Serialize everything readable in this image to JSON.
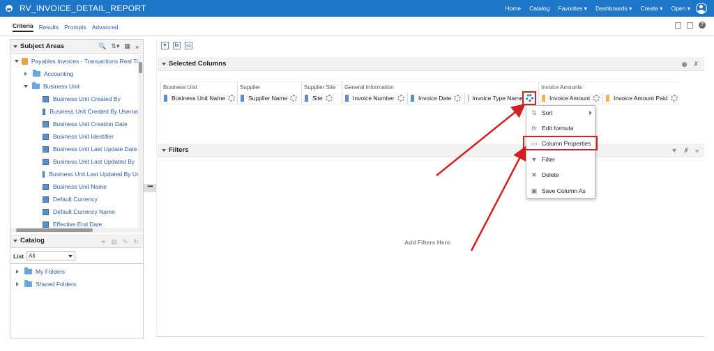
{
  "app": {
    "title": "RV_INVOICE_DETAIL_REPORT",
    "nav": [
      "Home",
      "Catalog",
      "Favorites ▾",
      "Dashboards ▾",
      "Create ▾",
      "Open ▾"
    ]
  },
  "tabs": [
    "Criteria",
    "Results",
    "Prompts",
    "Advanced"
  ],
  "subject_areas": {
    "header": "Subject Areas",
    "root": "Payables Invoices - Transactions Real Tim",
    "folders": [
      "Accounting",
      "Business Unit"
    ],
    "columns": [
      "Business Unit Created By",
      "Business Unit Created By Usernam",
      "Business Unit Creation Date",
      "Business Unit Identifier",
      "Business Unit Last Update Date",
      "Business Unit Last Updated By",
      "Business Unit Last Updated By Use",
      "Business Unit Name",
      "Default Currency",
      "Default Currency Name",
      "Effective End Date"
    ]
  },
  "catalog": {
    "header": "Catalog",
    "list_label": "List",
    "list_value": "All",
    "folders": [
      "My Folders",
      "Shared Folders"
    ]
  },
  "selected_columns": {
    "header": "Selected Columns",
    "groups": [
      "Business Unit",
      "Supplier",
      "Supplier Site",
      "General Information",
      "Invoice Amounts"
    ],
    "columns": [
      "Business Unit Name",
      "Supplier Name",
      "Site",
      "Invoice Number",
      "Invoice Date",
      "Invoice Type Name",
      "Invoice Amount",
      "Invoice Amount Paid"
    ]
  },
  "menu": {
    "items": [
      "Sort",
      "Edit formula",
      "Column Properties",
      "Filter",
      "Delete",
      "Save Column As"
    ]
  },
  "filters": {
    "header": "Filters",
    "placeholder": "Add Filters Here"
  },
  "colors": {
    "topbar": "#1d76c9",
    "highlight": "#d21f1f",
    "link": "#2a5da8"
  }
}
